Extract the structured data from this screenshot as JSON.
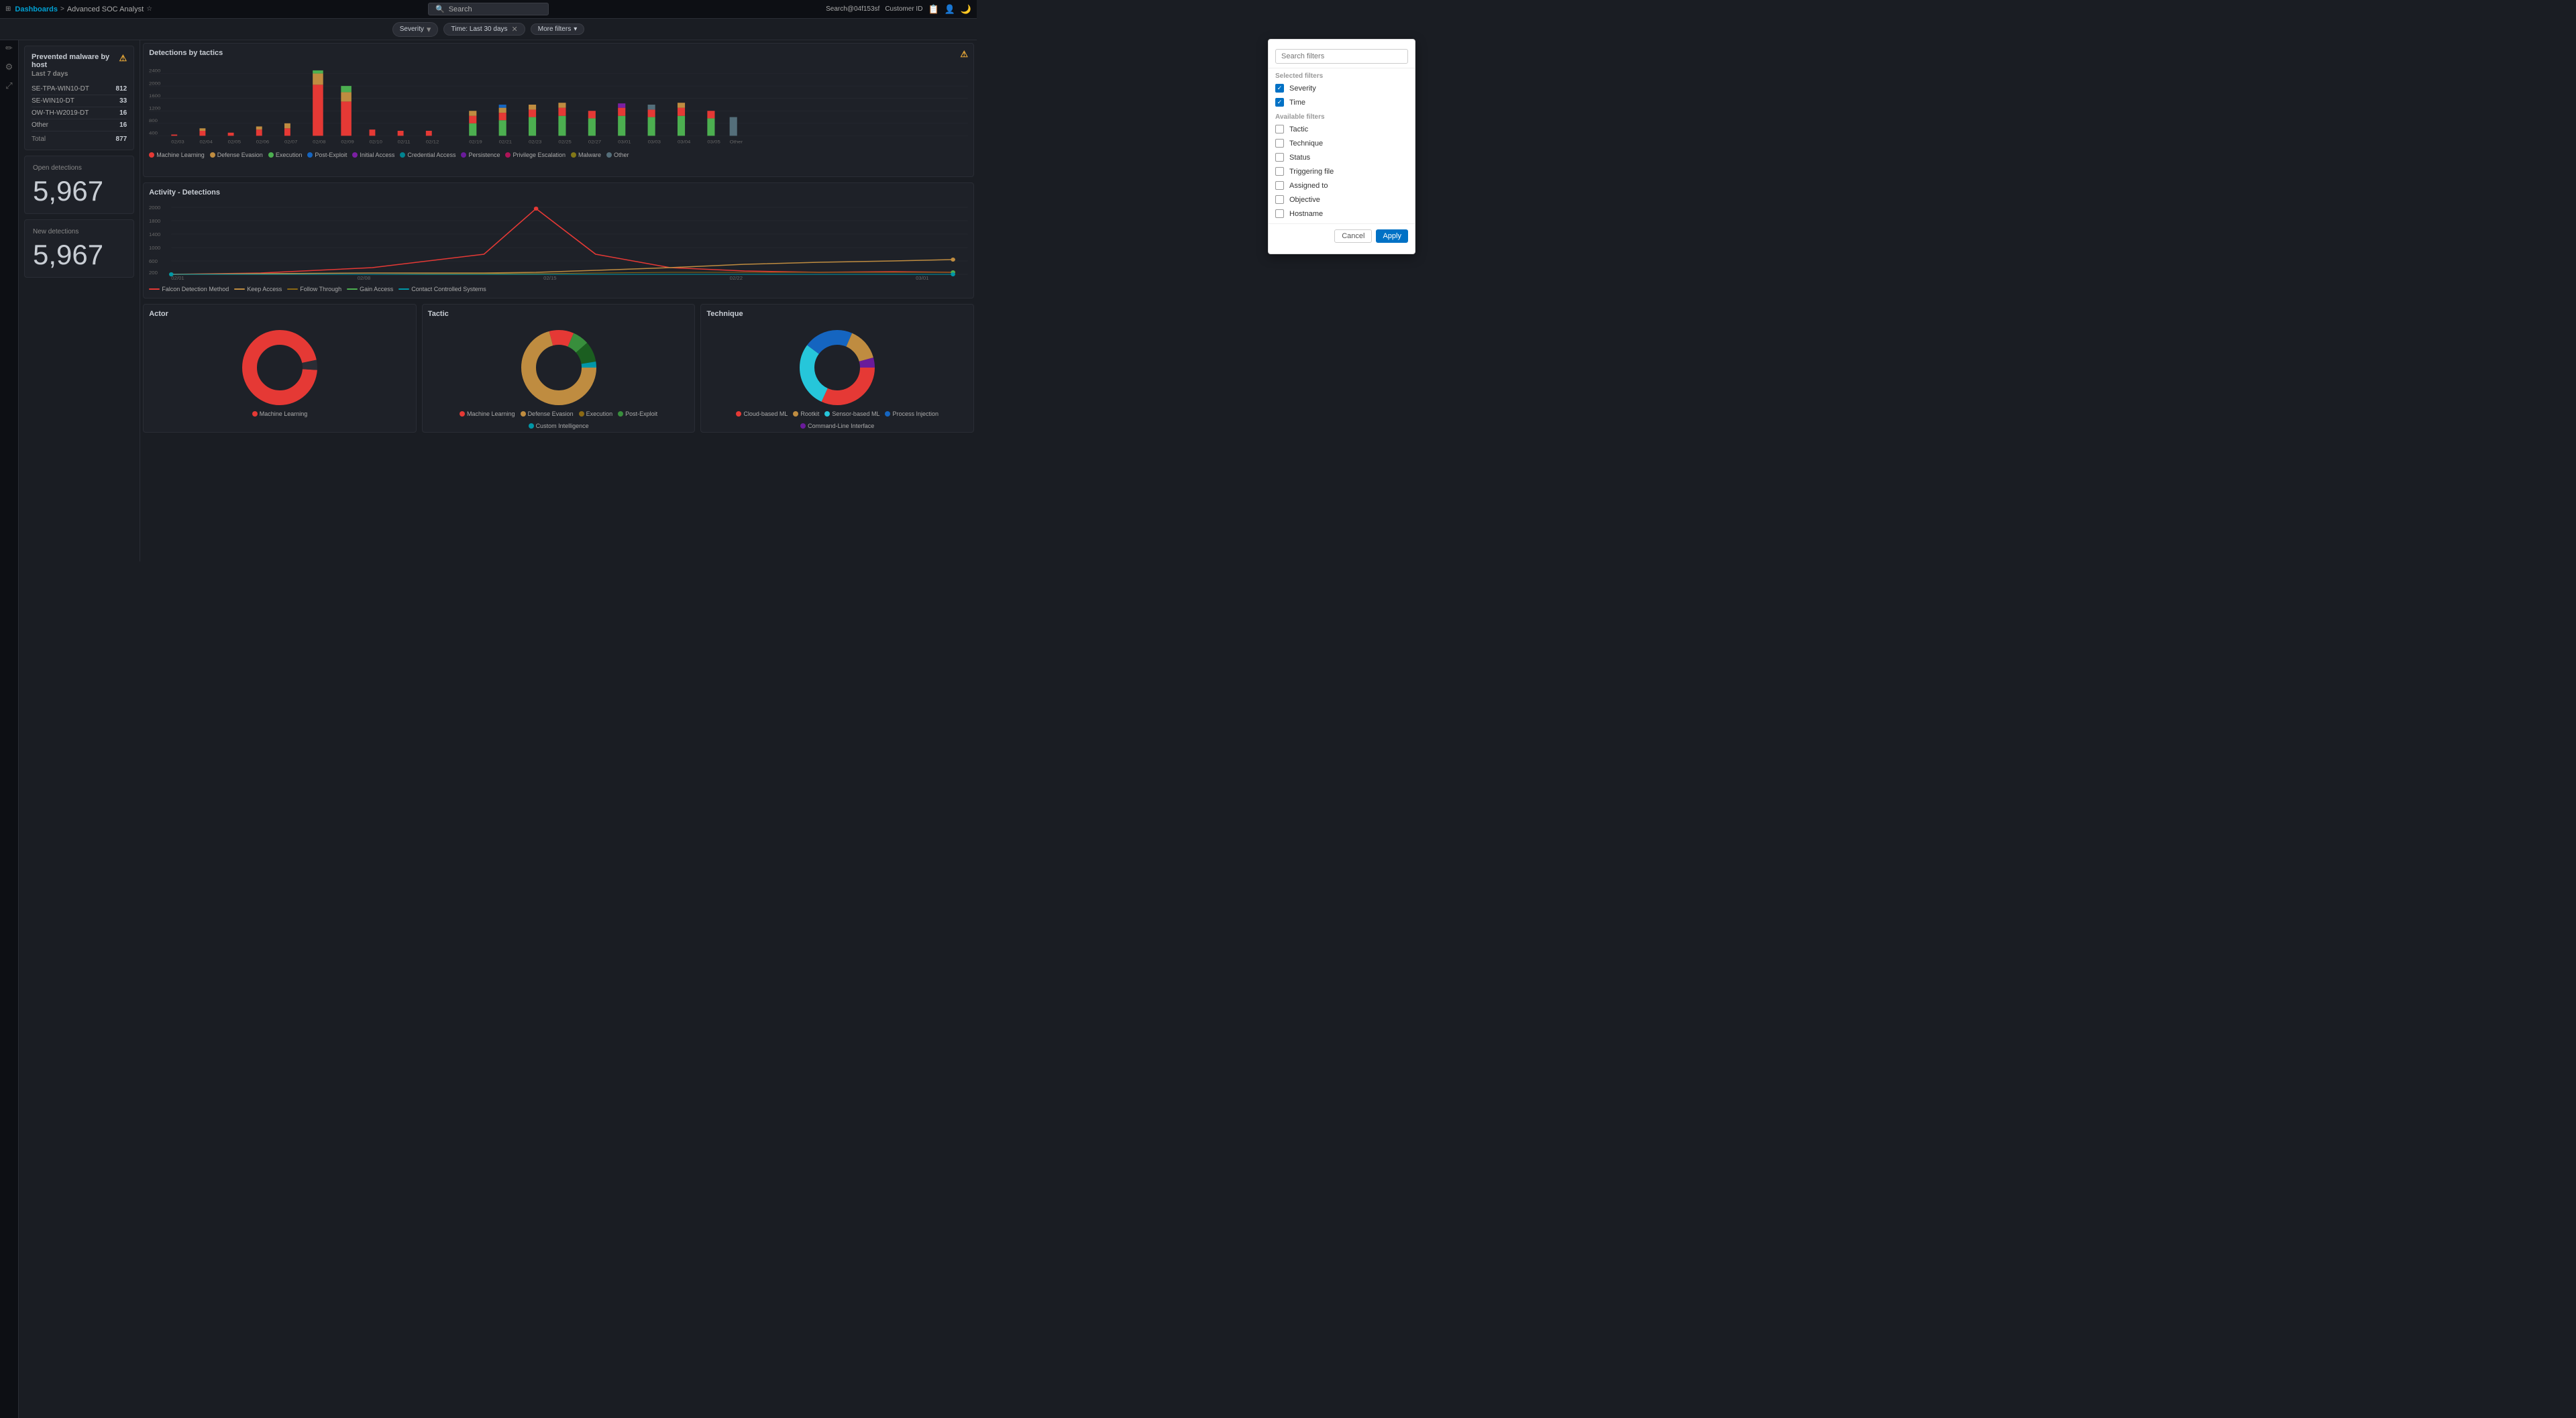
{
  "nav": {
    "logo": "⊞",
    "dashboards": "Dashboards",
    "arrow": ">",
    "subtitle": "Advanced SOC Analyst",
    "bookmark": "☆",
    "search_placeholder": "Search",
    "user": "Search@04f153sf",
    "customer": "Customer ID"
  },
  "filters": {
    "severity_label": "Severity",
    "time_label": "Time: Last 30 days",
    "more_filters_label": "More filters",
    "search_filters_placeholder": "Search filters",
    "selected_section": "Selected filters",
    "available_section": "Available filters",
    "selected_filters": [
      {
        "label": "Severity",
        "checked": true
      },
      {
        "label": "Time",
        "checked": true
      }
    ],
    "available_filters": [
      {
        "label": "Tactic",
        "checked": false
      },
      {
        "label": "Technique",
        "checked": false
      },
      {
        "label": "Status",
        "checked": false
      },
      {
        "label": "Triggering file",
        "checked": false
      },
      {
        "label": "Assigned to",
        "checked": false
      },
      {
        "label": "Objective",
        "checked": false
      },
      {
        "label": "Hostname",
        "checked": false
      }
    ],
    "cancel_btn": "Cancel",
    "apply_btn": "Apply"
  },
  "prevented_malware": {
    "title": "Prevented malware by host",
    "subtitle": "Last 7 days",
    "hosts": [
      {
        "name": "SE-TPA-WIN10-DT",
        "count": "812"
      },
      {
        "name": "SE-WIN10-DT",
        "count": "33"
      },
      {
        "name": "OW-TH-W2019-DT",
        "count": "16"
      },
      {
        "name": "Other",
        "count": "16"
      }
    ],
    "total_label": "Total",
    "total": "877"
  },
  "open_detections": {
    "label": "Open detections",
    "value": "5,967"
  },
  "new_detections": {
    "label": "New detections",
    "value": "5,967"
  },
  "detections_tactics": {
    "title": "Detections by tactics"
  },
  "activity": {
    "title": "Activity - Detections",
    "legend": [
      {
        "label": "Falcon Detection Method",
        "color": "#e53935"
      },
      {
        "label": "Keep Access",
        "color": "#bf8c40"
      },
      {
        "label": "Follow Through",
        "color": "#8b6914"
      },
      {
        "label": "Gain Access",
        "color": "#4caf50"
      },
      {
        "label": "Contact Controlled Systems",
        "color": "#0097a7"
      }
    ]
  },
  "actor": {
    "title": "Actor"
  },
  "tactic": {
    "title": "Tactic",
    "legend": [
      {
        "label": "Machine Learning",
        "color": "#e53935"
      },
      {
        "label": "Defense Evasion",
        "color": "#bf8c40"
      },
      {
        "label": "Execution",
        "color": "#8b6914"
      },
      {
        "label": "Post-Exploit",
        "color": "#388e3c"
      },
      {
        "label": "Custom Intelligence",
        "color": "#0097a7"
      }
    ]
  },
  "technique": {
    "title": "Technique",
    "legend": [
      {
        "label": "Cloud-based ML",
        "color": "#e53935"
      },
      {
        "label": "Rootkit",
        "color": "#bf8c40"
      },
      {
        "label": "Sensor-based ML",
        "color": "#26c6da"
      },
      {
        "label": "Process Injection",
        "color": "#1565c0"
      },
      {
        "label": "Command-Line Interface",
        "color": "#6a1b9a"
      }
    ]
  },
  "tactics_legend": [
    {
      "label": "Machine Learning",
      "color": "#e53935"
    },
    {
      "label": "Defense Evasion",
      "color": "#bf8c40"
    },
    {
      "label": "Execution",
      "color": "#4caf50"
    },
    {
      "label": "Post-Exploit",
      "color": "#1565c0"
    },
    {
      "label": "Initial Access",
      "color": "#7b1fa2"
    },
    {
      "label": "Credential Access",
      "color": "#00838f"
    },
    {
      "label": "Persistence",
      "color": "#6a1b9a"
    },
    {
      "label": "Privilege Escalation",
      "color": "#ad1457"
    },
    {
      "label": "Malware",
      "color": "#827717"
    },
    {
      "label": "Other",
      "color": "#546e7a"
    }
  ],
  "colors": {
    "accent": "#0071c5",
    "bg": "#1a1d23",
    "card_bg": "#1e2128",
    "border": "#2a2d35"
  }
}
